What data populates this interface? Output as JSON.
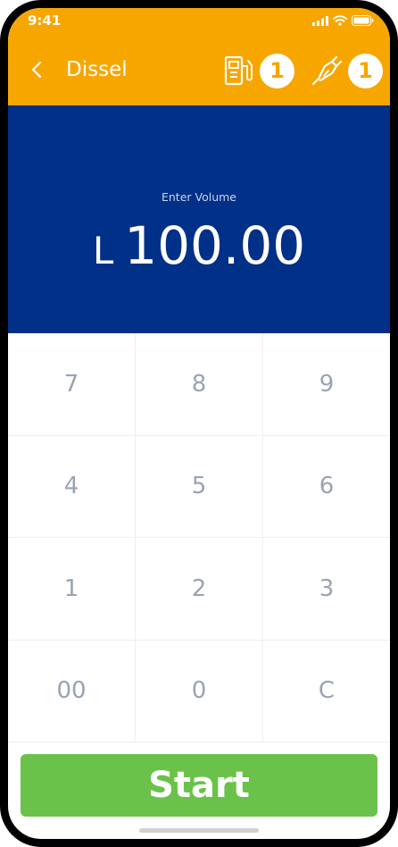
{
  "status_bar": {
    "time": "9:41",
    "icons": [
      "cellular-signal-icon",
      "wifi-icon",
      "battery-icon"
    ]
  },
  "header": {
    "back_icon": "chevron-left-icon",
    "title": "Dissel",
    "pump": {
      "icon": "fuel-pump-icon",
      "count": "1"
    },
    "nozzle": {
      "icon": "fuel-nozzle-icon",
      "count": "1"
    }
  },
  "display": {
    "label": "Enter Volume",
    "unit": "L",
    "value": "100.00"
  },
  "keypad": {
    "keys": [
      "7",
      "8",
      "9",
      "4",
      "5",
      "6",
      "1",
      "2",
      "3",
      "00",
      "0",
      "C"
    ]
  },
  "start_button": {
    "label": "Start"
  },
  "colors": {
    "header_bg": "#F7A600",
    "display_bg": "#003087",
    "start_bg": "#6BC24A",
    "key_text": "#9AA3B2"
  }
}
